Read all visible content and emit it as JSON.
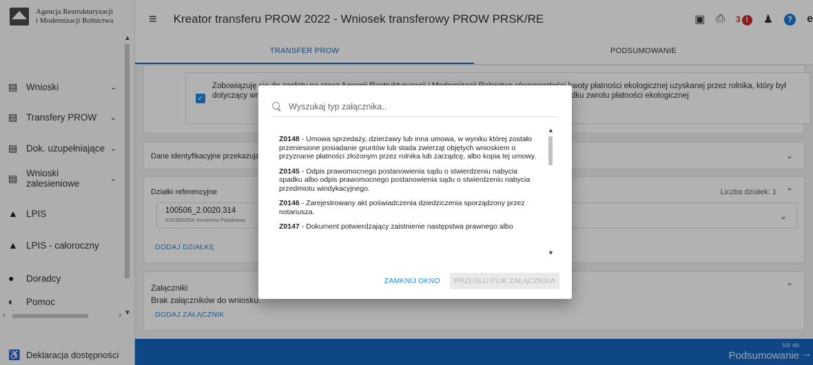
{
  "sidebar": {
    "logo_line1": "Agencja Restrukturyzacji",
    "logo_line2": "i Modernizacji Rolnictwa",
    "items": [
      {
        "label": "Wnioski",
        "chevron": "⌄"
      },
      {
        "label": "Transfery PROW",
        "chevron": "⌄"
      },
      {
        "label": "Dok. uzupełniające",
        "chevron": "⌄"
      },
      {
        "label": "Wnioski zalesieniowe",
        "chevron": "⌄"
      },
      {
        "label": "LPIS"
      },
      {
        "label": "LPIS - całoroczny"
      },
      {
        "label": "Doradcy"
      },
      {
        "label": "Pomoc"
      }
    ],
    "bottom_item": "Deklaracja dostępności"
  },
  "header": {
    "title": "Kreator transferu PROW 2022 - Wniosek transferowy PROW PRSK/RE",
    "alert_count": "3",
    "badge_symbol": "!"
  },
  "tabs": [
    {
      "label": "TRANSFER PROW"
    },
    {
      "label": "PODSUMOWANIE"
    }
  ],
  "content": {
    "commit_text_left": "Zobowiązuję się do zapłaty na rzecz Agencji Restrukturyzacji i Modernizacji Rolnictwa równowartości kwoty płatności ekologicznej uzyskanej przez rolnika, który był dotyczący wnioskiem, w okresie 2 lat od zakończenia realizacji zobowiązania ekologicznego, w przypadku zwrotu płatności ekologicznej",
    "identification_title": "Dane identyfikacyjne przekazującego",
    "parcels": {
      "title": "Działki referencyjne",
      "count_label": "Liczba działek: 1",
      "parcel_id": "100506_2.0020.314",
      "parcel_location": "KOCIERZEW, Kocierzew Południowy",
      "add_link": "DODAJ DZIAŁKĘ"
    },
    "attachments": {
      "title": "Załączniki",
      "empty": "Brak załączników do wniosku.",
      "add_link": "DODAJ ZAŁĄCZNIK"
    }
  },
  "footer": {
    "small": "Idź do",
    "big": "Podsumowanie"
  },
  "modal": {
    "search_placeholder": "Wyszukaj typ załącznika..",
    "items": [
      {
        "code": "Z0148",
        "text": " - Umowa sprzedaży, dzierżawy lub inna umowa, w wyniku której zostało przeniesione posiadanie gruntów lub stada zwierząt objętych wnioskiem o przyznanie płatności złożonym przez rolnika lub zarządcę, albo kopia tej umowy."
      },
      {
        "code": "Z0145",
        "text": " - Odpis prawomocnego postanowienia sądu o stwierdzeniu nabycia spadku albo odpis prawomocnego postanowienia sądu o stwierdzeniu nabycia przedmiotu windykacyjnego."
      },
      {
        "code": "Z0146",
        "text": " - Zarejestrowany akt poświadczenia dziedziczenia sporządzony przez notariusza."
      },
      {
        "code": "Z0147",
        "text": " - Dokument potwierdzający zaistnienie następstwa prawnego albo"
      }
    ],
    "close_label": "ZAMKNIJ OKNO",
    "send_label": "PRZEŚLIJ PLIK ZAŁĄCZNIKA"
  }
}
